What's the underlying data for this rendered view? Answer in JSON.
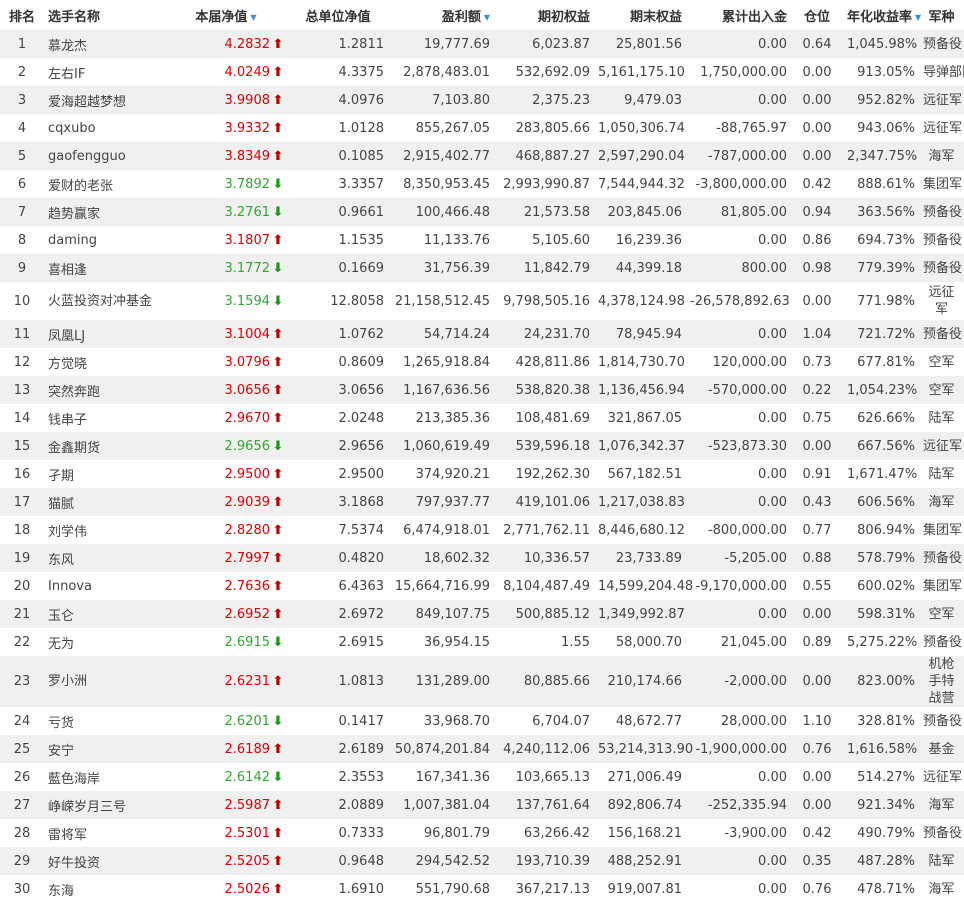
{
  "headers": {
    "rank": "排名",
    "name": "选手名称",
    "nav": "本届净值",
    "total_nav": "总单位净值",
    "profit": "盈利额",
    "start_equity": "期初权益",
    "end_equity": "期末权益",
    "net_flow": "累计出入金",
    "position": "仓位",
    "annual_return": "年化收益率",
    "army": "军种"
  },
  "colors": {
    "up": "#c00000",
    "down": "#1a9a1a",
    "sort_indicator": "#3a8fd8"
  },
  "rows": [
    {
      "rank": "1",
      "name": "慕龙杰",
      "nav": "4.2832",
      "dir": "up",
      "total_nav": "1.2811",
      "profit": "19,777.69",
      "start": "6,023.87",
      "end": "25,801.56",
      "flow": "0.00",
      "pos": "0.64",
      "annual": "1,045.98%",
      "army": "预备役"
    },
    {
      "rank": "2",
      "name": "左右IF",
      "nav": "4.0249",
      "dir": "up",
      "total_nav": "4.3375",
      "profit": "2,878,483.01",
      "start": "532,692.09",
      "end": "5,161,175.10",
      "flow": "1,750,000.00",
      "pos": "0.00",
      "annual": "913.05%",
      "army": "导弹部队"
    },
    {
      "rank": "3",
      "name": "爱海超越梦想",
      "nav": "3.9908",
      "dir": "up",
      "total_nav": "4.0976",
      "profit": "7,103.80",
      "start": "2,375.23",
      "end": "9,479.03",
      "flow": "0.00",
      "pos": "0.00",
      "annual": "952.82%",
      "army": "远征军"
    },
    {
      "rank": "4",
      "name": "cqxubo",
      "nav": "3.9332",
      "dir": "up",
      "total_nav": "1.0128",
      "profit": "855,267.05",
      "start": "283,805.66",
      "end": "1,050,306.74",
      "flow": "-88,765.97",
      "pos": "0.00",
      "annual": "943.06%",
      "army": "远征军"
    },
    {
      "rank": "5",
      "name": "gaofengguo",
      "nav": "3.8349",
      "dir": "up",
      "total_nav": "0.1085",
      "profit": "2,915,402.77",
      "start": "468,887.27",
      "end": "2,597,290.04",
      "flow": "-787,000.00",
      "pos": "0.00",
      "annual": "2,347.75%",
      "army": "海军"
    },
    {
      "rank": "6",
      "name": "爱财的老张",
      "nav": "3.7892",
      "dir": "down",
      "total_nav": "3.3357",
      "profit": "8,350,953.45",
      "start": "2,993,990.87",
      "end": "7,544,944.32",
      "flow": "-3,800,000.00",
      "pos": "0.42",
      "annual": "888.61%",
      "army": "集团军"
    },
    {
      "rank": "7",
      "name": "趋势赢家",
      "nav": "3.2761",
      "dir": "down",
      "total_nav": "0.9661",
      "profit": "100,466.48",
      "start": "21,573.58",
      "end": "203,845.06",
      "flow": "81,805.00",
      "pos": "0.94",
      "annual": "363.56%",
      "army": "预备役"
    },
    {
      "rank": "8",
      "name": "daming",
      "nav": "3.1807",
      "dir": "up",
      "total_nav": "1.1535",
      "profit": "11,133.76",
      "start": "5,105.60",
      "end": "16,239.36",
      "flow": "0.00",
      "pos": "0.86",
      "annual": "694.73%",
      "army": "预备役"
    },
    {
      "rank": "9",
      "name": "喜相逢",
      "nav": "3.1772",
      "dir": "down",
      "total_nav": "0.1669",
      "profit": "31,756.39",
      "start": "11,842.79",
      "end": "44,399.18",
      "flow": "800.00",
      "pos": "0.98",
      "annual": "779.39%",
      "army": "预备役"
    },
    {
      "rank": "10",
      "name": "火蓝投资对冲基金",
      "nav": "3.1594",
      "dir": "down",
      "total_nav": "12.8058",
      "profit": "21,158,512.45",
      "start": "9,798,505.16",
      "end": "4,378,124.98",
      "flow": "-26,578,892.63",
      "pos": "0.00",
      "annual": "771.98%",
      "army": "远征军"
    },
    {
      "rank": "11",
      "name": "凤凰LJ",
      "nav": "3.1004",
      "dir": "up",
      "total_nav": "1.0762",
      "profit": "54,714.24",
      "start": "24,231.70",
      "end": "78,945.94",
      "flow": "0.00",
      "pos": "1.04",
      "annual": "721.72%",
      "army": "预备役"
    },
    {
      "rank": "12",
      "name": "方觉晓",
      "nav": "3.0796",
      "dir": "up",
      "total_nav": "0.8609",
      "profit": "1,265,918.84",
      "start": "428,811.86",
      "end": "1,814,730.70",
      "flow": "120,000.00",
      "pos": "0.73",
      "annual": "677.81%",
      "army": "空军"
    },
    {
      "rank": "13",
      "name": "突然奔跑",
      "nav": "3.0656",
      "dir": "up",
      "total_nav": "3.0656",
      "profit": "1,167,636.56",
      "start": "538,820.38",
      "end": "1,136,456.94",
      "flow": "-570,000.00",
      "pos": "0.22",
      "annual": "1,054.23%",
      "army": "空军"
    },
    {
      "rank": "14",
      "name": "钱串子",
      "nav": "2.9670",
      "dir": "up",
      "total_nav": "2.0248",
      "profit": "213,385.36",
      "start": "108,481.69",
      "end": "321,867.05",
      "flow": "0.00",
      "pos": "0.75",
      "annual": "626.66%",
      "army": "陆军"
    },
    {
      "rank": "15",
      "name": "金鑫期货",
      "nav": "2.9656",
      "dir": "down",
      "total_nav": "2.9656",
      "profit": "1,060,619.49",
      "start": "539,596.18",
      "end": "1,076,342.37",
      "flow": "-523,873.30",
      "pos": "0.00",
      "annual": "667.56%",
      "army": "远征军"
    },
    {
      "rank": "16",
      "name": "孑期",
      "nav": "2.9500",
      "dir": "up",
      "total_nav": "2.9500",
      "profit": "374,920.21",
      "start": "192,262.30",
      "end": "567,182.51",
      "flow": "0.00",
      "pos": "0.91",
      "annual": "1,671.47%",
      "army": "陆军"
    },
    {
      "rank": "17",
      "name": "猫腻",
      "nav": "2.9039",
      "dir": "up",
      "total_nav": "3.1868",
      "profit": "797,937.77",
      "start": "419,101.06",
      "end": "1,217,038.83",
      "flow": "0.00",
      "pos": "0.43",
      "annual": "606.56%",
      "army": "海军"
    },
    {
      "rank": "18",
      "name": "刘学伟",
      "nav": "2.8280",
      "dir": "up",
      "total_nav": "7.5374",
      "profit": "6,474,918.01",
      "start": "2,771,762.11",
      "end": "8,446,680.12",
      "flow": "-800,000.00",
      "pos": "0.77",
      "annual": "806.94%",
      "army": "集团军"
    },
    {
      "rank": "19",
      "name": "东风",
      "nav": "2.7997",
      "dir": "up",
      "total_nav": "0.4820",
      "profit": "18,602.32",
      "start": "10,336.57",
      "end": "23,733.89",
      "flow": "-5,205.00",
      "pos": "0.88",
      "annual": "578.79%",
      "army": "预备役"
    },
    {
      "rank": "20",
      "name": "Innova",
      "nav": "2.7636",
      "dir": "up",
      "total_nav": "6.4363",
      "profit": "15,664,716.99",
      "start": "8,104,487.49",
      "end": "14,599,204.48",
      "flow": "-9,170,000.00",
      "pos": "0.55",
      "annual": "600.02%",
      "army": "集团军"
    },
    {
      "rank": "21",
      "name": "玉仑",
      "nav": "2.6952",
      "dir": "up",
      "total_nav": "2.6972",
      "profit": "849,107.75",
      "start": "500,885.12",
      "end": "1,349,992.87",
      "flow": "0.00",
      "pos": "0.00",
      "annual": "598.31%",
      "army": "空军"
    },
    {
      "rank": "22",
      "name": "无为",
      "nav": "2.6915",
      "dir": "down",
      "total_nav": "2.6915",
      "profit": "36,954.15",
      "start": "1.55",
      "end": "58,000.70",
      "flow": "21,045.00",
      "pos": "0.89",
      "annual": "5,275.22%",
      "army": "预备役"
    },
    {
      "rank": "23",
      "name": "罗小洲",
      "nav": "2.6231",
      "dir": "up",
      "total_nav": "1.0813",
      "profit": "131,289.00",
      "start": "80,885.66",
      "end": "210,174.66",
      "flow": "-2,000.00",
      "pos": "0.00",
      "annual": "823.00%",
      "army": "机枪手特战营"
    },
    {
      "rank": "24",
      "name": "亏货",
      "nav": "2.6201",
      "dir": "down",
      "total_nav": "0.1417",
      "profit": "33,968.70",
      "start": "6,704.07",
      "end": "48,672.77",
      "flow": "28,000.00",
      "pos": "1.10",
      "annual": "328.81%",
      "army": "预备役"
    },
    {
      "rank": "25",
      "name": "安宁",
      "nav": "2.6189",
      "dir": "up",
      "total_nav": "2.6189",
      "profit": "50,874,201.84",
      "start": "4,240,112.06",
      "end": "53,214,313.90",
      "flow": "-1,900,000.00",
      "pos": "0.76",
      "annual": "1,616.58%",
      "army": "基金"
    },
    {
      "rank": "26",
      "name": "藍色海岸",
      "nav": "2.6142",
      "dir": "down",
      "total_nav": "2.3553",
      "profit": "167,341.36",
      "start": "103,665.13",
      "end": "271,006.49",
      "flow": "0.00",
      "pos": "0.00",
      "annual": "514.27%",
      "army": "远征军"
    },
    {
      "rank": "27",
      "name": "峥嵘岁月三号",
      "nav": "2.5987",
      "dir": "up",
      "total_nav": "2.0889",
      "profit": "1,007,381.04",
      "start": "137,761.64",
      "end": "892,806.74",
      "flow": "-252,335.94",
      "pos": "0.00",
      "annual": "921.34%",
      "army": "海军"
    },
    {
      "rank": "28",
      "name": "雷将军",
      "nav": "2.5301",
      "dir": "up",
      "total_nav": "0.7333",
      "profit": "96,801.79",
      "start": "63,266.42",
      "end": "156,168.21",
      "flow": "-3,900.00",
      "pos": "0.42",
      "annual": "490.79%",
      "army": "预备役"
    },
    {
      "rank": "29",
      "name": "好牛投资",
      "nav": "2.5205",
      "dir": "up",
      "total_nav": "0.9648",
      "profit": "294,542.52",
      "start": "193,710.39",
      "end": "488,252.91",
      "flow": "0.00",
      "pos": "0.35",
      "annual": "487.28%",
      "army": "陆军"
    },
    {
      "rank": "30",
      "name": "东海",
      "nav": "2.5026",
      "dir": "up",
      "total_nav": "1.6910",
      "profit": "551,790.68",
      "start": "367,217.13",
      "end": "919,007.81",
      "flow": "0.00",
      "pos": "0.76",
      "annual": "478.71%",
      "army": "海军"
    }
  ]
}
